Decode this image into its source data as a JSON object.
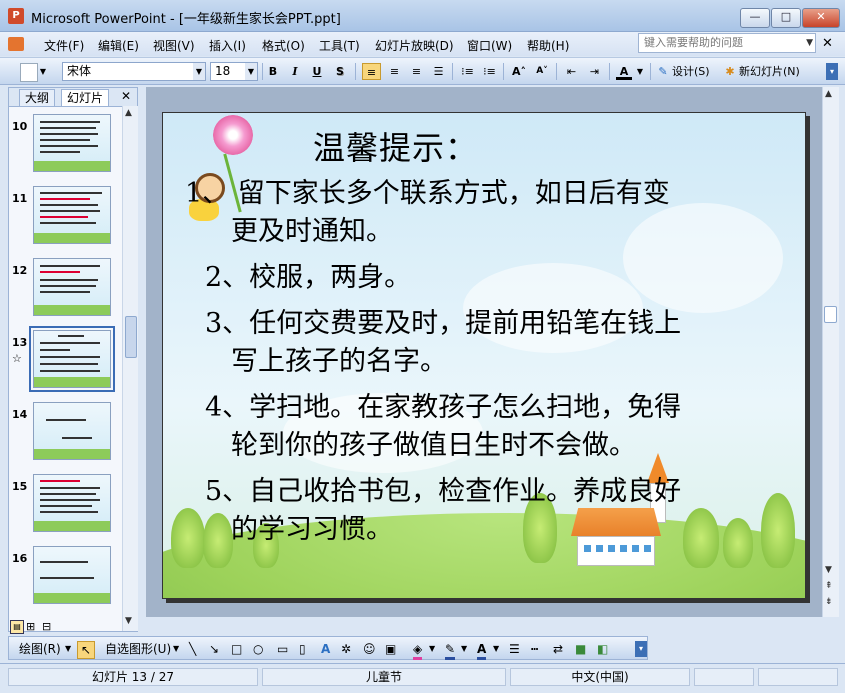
{
  "window": {
    "title": "Microsoft PowerPoint - [一年级新生家长会PPT.ppt]",
    "app_icon": "P",
    "controls": {
      "minimize": "—",
      "maximize": "□",
      "close": "✕"
    }
  },
  "menubar": {
    "items": [
      "文件(F)",
      "编辑(E)",
      "视图(V)",
      "插入(I)",
      "格式(O)",
      "工具(T)",
      "幻灯片放映(D)",
      "窗口(W)",
      "帮助(H)"
    ],
    "help_placeholder": "键入需要帮助的问题",
    "doc_close": "✕"
  },
  "toolbar": {
    "font_name": "宋体",
    "font_size": "18",
    "bold": "B",
    "italic": "I",
    "underline": "U",
    "shadow": "S",
    "font_color": "A",
    "design_label": "设计(S)",
    "new_slide_label": "新幻灯片(N)"
  },
  "left_pane": {
    "tabs": [
      "大纲",
      "幻灯片"
    ],
    "close": "✕",
    "slides": [
      {
        "num": "10"
      },
      {
        "num": "11"
      },
      {
        "num": "12"
      },
      {
        "num": "13",
        "selected": true
      },
      {
        "num": "14"
      },
      {
        "num": "15"
      },
      {
        "num": "16"
      }
    ],
    "star": "☆"
  },
  "slide": {
    "title": "温馨提示：",
    "lines": [
      "1、 留下家长多个联系方式，如日后有变",
      "更及时通知。",
      "2、校服，两身。",
      "3、任何交费要及时，提前用铅笔在钱上",
      "写上孩子的名字。",
      "4、学扫地。在家教孩子怎么扫地，免得",
      "轮到你的孩子做值日生时不会做。",
      "5、自己收拾书包，检查作业。养成良好",
      "的学习习惯。"
    ]
  },
  "drawbar": {
    "draw_label": "绘图(R)",
    "autoshape_label": "自选图形(U)"
  },
  "statusbar": {
    "slide_info": "幻灯片 13 / 27",
    "design": "儿童节",
    "language": "中文(中国)"
  }
}
